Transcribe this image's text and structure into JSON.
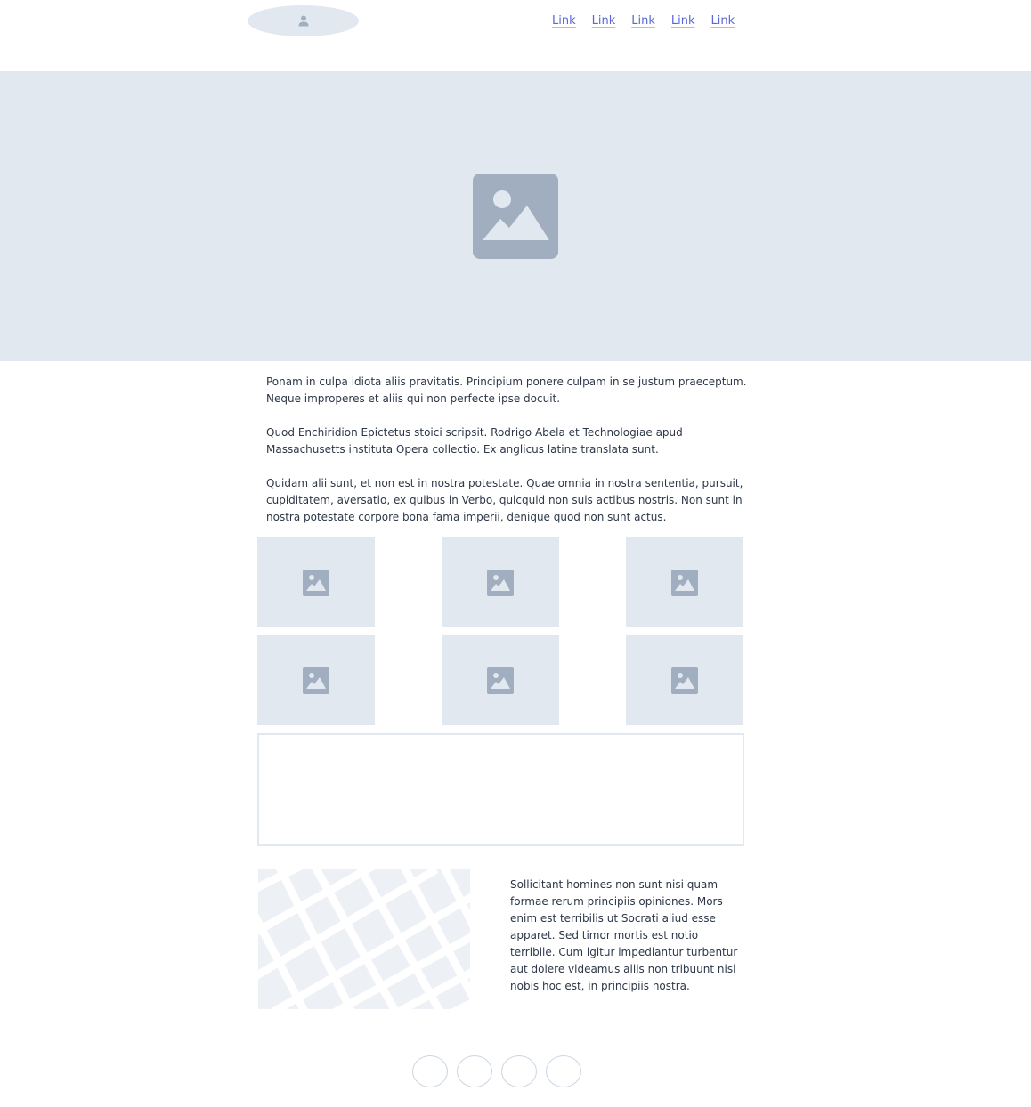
{
  "header": {
    "logo_icon": "user-icon",
    "nav_links": [
      "Link",
      "Link",
      "Link",
      "Link",
      "Link"
    ],
    "link_color": "#5a67d8"
  },
  "hero": {
    "icon": "image-placeholder-icon",
    "background": "#e2e8f0"
  },
  "content": {
    "paragraphs": [
      "Ponam in culpa idiota aliis pravitatis. Principium ponere culpam in se justum praeceptum. Neque improperes et aliis qui non perfecte ipse docuit.",
      "Quod Enchiridion Epictetus stoici scripsit. Rodrigo Abela et Technologiae apud Massachusetts instituta Opera collectio. Ex anglicus latine translata sunt.",
      "Quidam alii sunt, et non est in nostra potestate. Quae omnia in nostra sententia, pursuit, cupiditatem, aversatio, ex quibus in Verbo, quicquid non suis actibus nostris. Non sunt in nostra potestate corpore bona fama imperii, denique quod non sunt actus."
    ]
  },
  "gallery": {
    "items": [
      {
        "icon": "image-placeholder-icon"
      },
      {
        "icon": "image-placeholder-icon"
      },
      {
        "icon": "image-placeholder-icon"
      },
      {
        "icon": "image-placeholder-icon"
      },
      {
        "icon": "image-placeholder-icon"
      },
      {
        "icon": "image-placeholder-icon"
      }
    ]
  },
  "map_section": {
    "map_icon": "map-placeholder",
    "text": "Sollicitant homines non sunt nisi quam formae rerum principiis opiniones. Mors enim est terribilis ut Socrati aliud esse apparet. Sed timor mortis est notio terribile. Cum igitur impediantur turbentur aut dolere videamus aliis non tribuunt nisi nobis hoc est, in principiis nostra."
  },
  "footer": {
    "circle_count": 4
  }
}
